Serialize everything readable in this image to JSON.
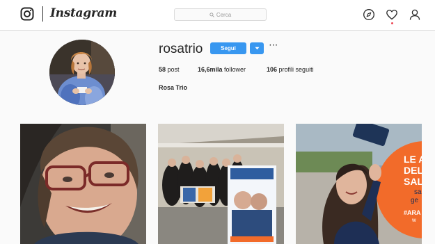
{
  "nav": {
    "brand": "Instagram",
    "search_placeholder": "Cerca",
    "icons": [
      "instagram-logo-icon",
      "search-icon",
      "compass-icon",
      "heart-icon",
      "user-icon"
    ],
    "notification_dot_color": "#ed4956"
  },
  "profile": {
    "username": "rosatrio",
    "follow_label": "Segui",
    "more_label": "···",
    "stats": {
      "posts_count": "58",
      "posts_label": "post",
      "followers_count": "16,6mila",
      "followers_label": "follower",
      "following_count": "106",
      "following_label": "profili seguiti"
    },
    "full_name": "Rosa Trio"
  },
  "posts": {
    "third": {
      "text_line1": "LE A",
      "text_line2": "DEL",
      "text_line3": "SAL",
      "text_line4": "sa",
      "text_line5": "ge",
      "hashtag": "#ARA",
      "text_line7": "w"
    }
  },
  "colors": {
    "accent": "#3897f0",
    "border": "#dbdbdb",
    "background": "#fafafa",
    "text": "#262626",
    "poster_orange": "#f26b2a"
  }
}
